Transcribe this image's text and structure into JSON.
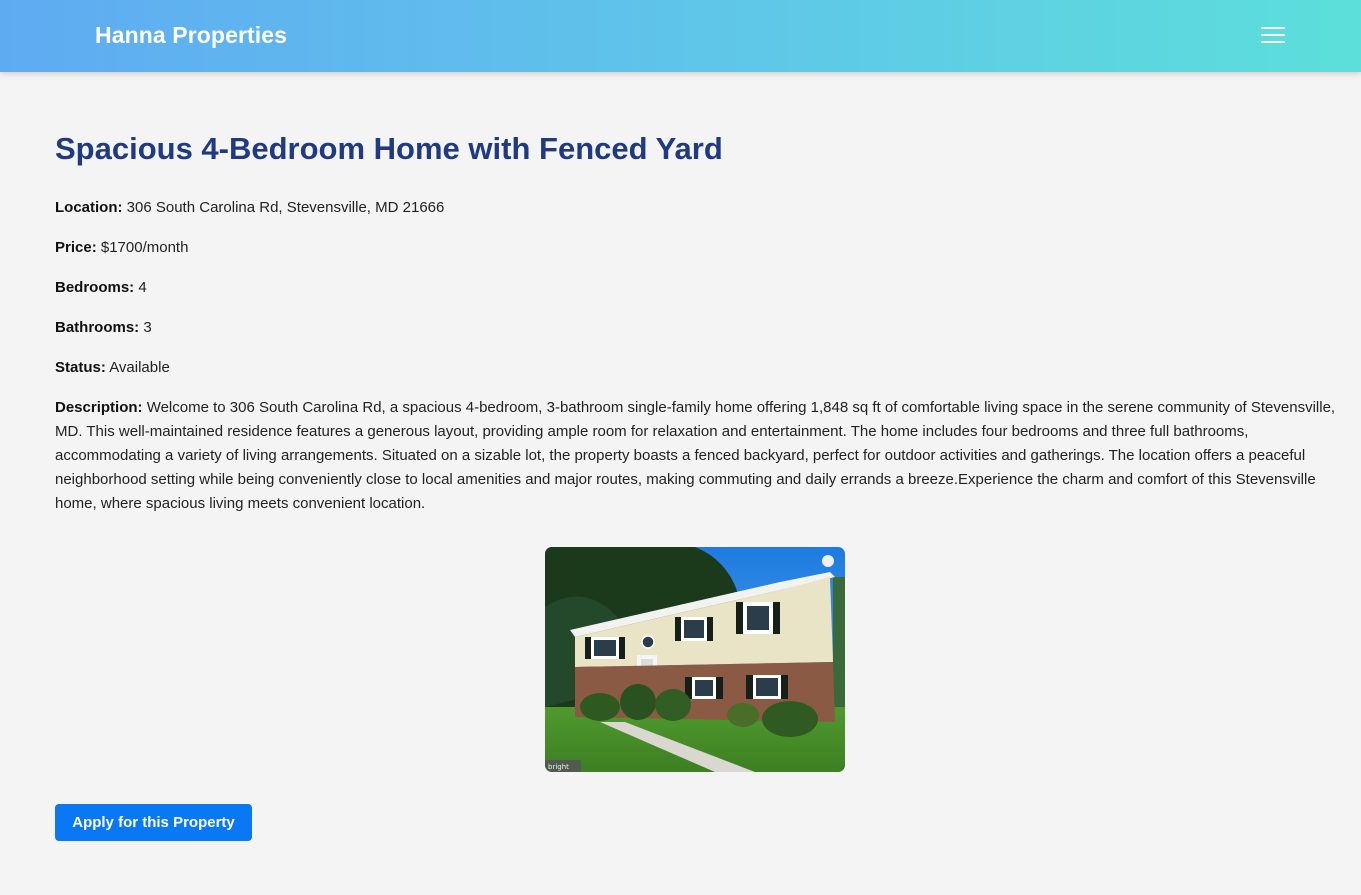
{
  "navbar": {
    "brand": "Hanna Properties",
    "menu_icon": "hamburger-menu-icon",
    "gradient_colors": [
      "#5fabf2",
      "#5cdfda"
    ]
  },
  "listing": {
    "title": "Spacious 4-Bedroom Home with Fenced Yard",
    "title_color": "#1f3a80",
    "fields": [
      {
        "label": "Location:",
        "value": "306 South Carolina Rd, Stevensville, MD 21666"
      },
      {
        "label": "Price:",
        "value": "$1700/month"
      },
      {
        "label": "Bedrooms:",
        "value": "4"
      },
      {
        "label": "Bathrooms:",
        "value": "3"
      },
      {
        "label": "Status:",
        "value": "Available"
      }
    ],
    "description_label": "Description:",
    "description": "Welcome to 306 South Carolina Rd, a spacious 4-bedroom, 3-bathroom single-family home offering 1,848 sq ft of comfortable living space in the serene community of Stevensville, MD. This well-maintained residence features a generous layout, providing ample room for relaxation and entertainment. The home includes four bedrooms and three full bathrooms, accommodating a variety of living arrangements. Situated on a sizable lot, the property boasts a fenced backyard, perfect for outdoor activities and gatherings. The location offers a peaceful neighborhood setting while being conveniently close to local amenities and major routes, making commuting and daily errands a breeze.Experience the charm and comfort of this Stevensville home, where spacious living meets convenient location.",
    "photo_watermark": "bright"
  },
  "actions": {
    "apply_label": "Apply for this Property",
    "apply_color": "#0a78f5"
  }
}
